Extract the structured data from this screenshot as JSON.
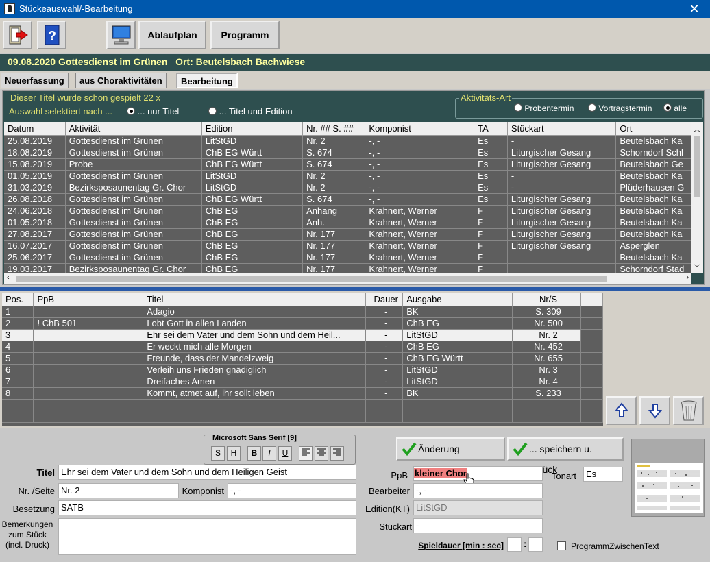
{
  "window": {
    "title": "Stückeauswahl/-Bearbeitung"
  },
  "toolbar": {
    "ablaufplan": "Ablaufplan",
    "programm": "Programm"
  },
  "event": {
    "header": "09.08.2020 Gottesdienst im Grünen   Ort: Beutelsbach Bachwiese"
  },
  "tabs": [
    "Neuerfassung",
    "aus Choraktivitäten",
    "Bearbeitung"
  ],
  "history": {
    "played_text": "Dieser Titel wurde schon gespielt  22 x",
    "select_text": "Auswahl selektiert nach ...",
    "opt_title": "... nur Titel",
    "opt_title_edition": "...  Titel und Edition",
    "activity_group": "Aktivitäts-Art",
    "opt_rehearsal": "Probentermin",
    "opt_concert": "Vortragstermin",
    "opt_all": "alle",
    "columns": [
      "Datum",
      "Aktivität",
      "Edition",
      "Nr. ## S. ##",
      "Komponist",
      "TA",
      "Stückart",
      "Ort"
    ],
    "rows": [
      [
        "25.08.2019",
        "Gottesdienst im Grünen",
        "LitStGD",
        "Nr. 2",
        "-, -",
        "Es",
        "-",
        "Beutelsbach Ka"
      ],
      [
        "18.08.2019",
        "Gottesdienst im Grünen",
        "ChB EG Württ",
        "S. 674",
        "-, -",
        "Es",
        "Liturgischer Gesang",
        "Schorndorf Schl"
      ],
      [
        "15.08.2019",
        "Probe",
        "ChB EG Württ",
        "S. 674",
        "-, -",
        "Es",
        "Liturgischer Gesang",
        "Beutelsbach Ge"
      ],
      [
        "01.05.2019",
        "Gottesdienst im Grünen",
        "LitStGD",
        "Nr. 2",
        "-, -",
        "Es",
        "-",
        "Beutelsbach Ka"
      ],
      [
        "31.03.2019",
        "Bezirksposaunentag Gr. Chor",
        "LitStGD",
        "Nr. 2",
        "-, -",
        "Es",
        "-",
        "Plüderhausen G"
      ],
      [
        "26.08.2018",
        "Gottesdienst im Grünen",
        "ChB EG Württ",
        "S. 674",
        "-, -",
        "Es",
        "Liturgischer Gesang",
        "Beutelsbach Ka"
      ],
      [
        "24.06.2018",
        "Gottesdienst im Grünen",
        "ChB EG",
        "Anhang",
        "Krahnert, Werner",
        "F",
        "Liturgischer Gesang",
        "Beutelsbach Ka"
      ],
      [
        "01.05.2018",
        "Gottesdienst im Grünen",
        "ChB EG",
        "Anh.",
        "Krahnert, Werner",
        "F",
        "Liturgischer Gesang",
        "Beutelsbach Ka"
      ],
      [
        "27.08.2017",
        "Gottesdienst im Grünen",
        "ChB EG",
        "Nr. 177",
        "Krahnert, Werner",
        "F",
        "Liturgischer Gesang",
        "Beutelsbach Ka"
      ],
      [
        "16.07.2017",
        "Gottesdienst im Grünen",
        "ChB EG",
        "Nr. 177",
        "Krahnert, Werner",
        "F",
        "Liturgischer Gesang",
        "Asperglen"
      ],
      [
        "25.06.2017",
        "Gottesdienst im Grünen",
        "ChB EG",
        "Nr. 177",
        "Krahnert, Werner",
        "F",
        "",
        "Beutelsbach Ka"
      ],
      [
        "19.03.2017",
        "Bezirksposaunentag Gr. Chor",
        "ChB EG",
        "Nr. 177",
        "Krahnert, Werner",
        "F",
        "",
        "Schorndorf Stad"
      ]
    ]
  },
  "program": {
    "columns": [
      "Pos.",
      "PpB",
      "Titel",
      "Dauer",
      "Ausgabe",
      "Nr/S"
    ],
    "rows": [
      [
        "1",
        "",
        "Adagio",
        "-",
        "BK",
        "S. 309"
      ],
      [
        "2",
        "! ChB 501",
        "Lobt Gott in allen Landen",
        "-",
        "ChB EG",
        "Nr. 500"
      ],
      [
        "3",
        "",
        "Ehr sei dem Vater und dem Sohn und dem Heil...",
        "-",
        "LitStGD",
        "Nr. 2"
      ],
      [
        "4",
        "",
        "Er weckt mich alle Morgen",
        "-",
        "ChB EG",
        "Nr. 452"
      ],
      [
        "5",
        "",
        "Freunde, dass der Mandelzweig",
        "-",
        "ChB EG Württ",
        "Nr. 655"
      ],
      [
        "6",
        "",
        "Verleih uns Frieden gnädiglich",
        "-",
        "LitStGD",
        "Nr. 3"
      ],
      [
        "7",
        "",
        "Dreifaches Amen",
        "-",
        "LitStGD",
        "Nr. 4"
      ],
      [
        "8",
        "",
        "Kommt, atmet auf, ihr sollt leben",
        "-",
        "BK",
        "S. 233"
      ]
    ],
    "selected_row": 3
  },
  "format": {
    "font": "Microsoft Sans Serif  [9]",
    "btn_s": "S",
    "btn_h": "H",
    "btn_b": "B",
    "btn_i": "I",
    "btn_u": "U"
  },
  "editor": {
    "title_label": "Titel",
    "title_value": "Ehr sei dem Vater und dem Sohn und dem Heiligen Geist",
    "nr_label": "Nr. /Seite",
    "nr_value": "Nr. 2",
    "composer_label": "Komponist",
    "composer_value": "-, -",
    "besetzung_label": "Besetzung",
    "besetzung_value": "SATB",
    "notes_label": "Bemerkungen\nzum Stück\n(incl. Druck)",
    "ppb_label": "PpB",
    "ppb_value": "kleiner Chor",
    "tonart_label": "Tonart",
    "tonart_value": "Es",
    "bearbeiter_label": "Bearbeiter",
    "bearbeiter_value": "-, -",
    "edition_label": "Edition(KT)",
    "edition_value": "LitStGD",
    "stueckart_label": "Stückart",
    "stueckart_value": "-",
    "duration_label": "Spieldauer [min : sec]",
    "duration_sep": ":",
    "save_label": "Änderung speichern",
    "save_back_label": "... speichern u. zurück",
    "zwischen_label": "ProgrammZwischenText"
  }
}
